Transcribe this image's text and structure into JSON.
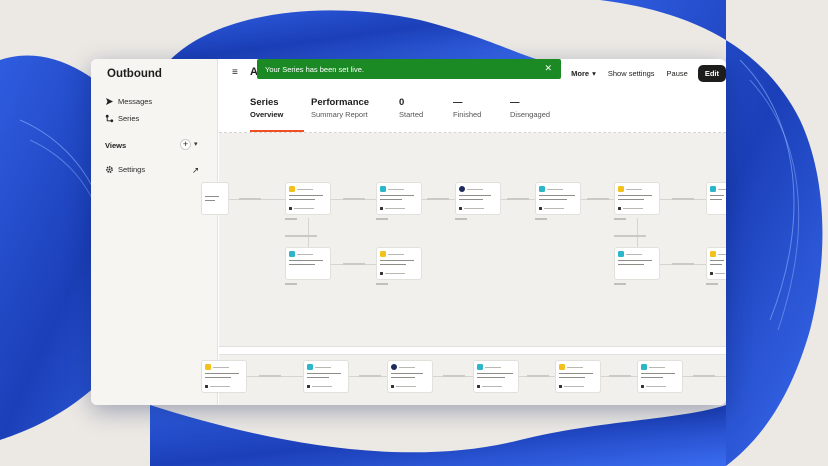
{
  "app": {
    "brand": "Outbound",
    "title_partial": "A"
  },
  "sidebar": {
    "items": [
      {
        "label": "Messages",
        "icon": "send-icon"
      },
      {
        "label": "Series",
        "icon": "series-icon"
      }
    ],
    "views_label": "Views",
    "settings_label": "Settings"
  },
  "toast": {
    "message": "Your Series has been set live.",
    "close_glyph": "✕",
    "color": "#1b8a24"
  },
  "toolbar": {
    "menu_glyph": "≡",
    "more_label": "More",
    "show_settings_label": "Show settings",
    "pause_label": "Pause",
    "edit_label": "Edit"
  },
  "tabs": [
    {
      "title": "Series",
      "subtitle": "Overview",
      "active": true
    },
    {
      "title": "Performance",
      "subtitle": "Summary Report",
      "active": false
    }
  ],
  "stats": [
    {
      "value": "0",
      "label": "Started"
    },
    {
      "value": "—",
      "label": "Finished"
    },
    {
      "value": "—",
      "label": "Disengaged"
    }
  ],
  "colors": {
    "accent": "#f04e23",
    "edit_bg": "#1d1d1b",
    "canvas_bg": "#f1f0ec",
    "node_yellow": "#f2c21b",
    "node_teal": "#2bb6c9",
    "node_navy": "#1e2a5a"
  }
}
